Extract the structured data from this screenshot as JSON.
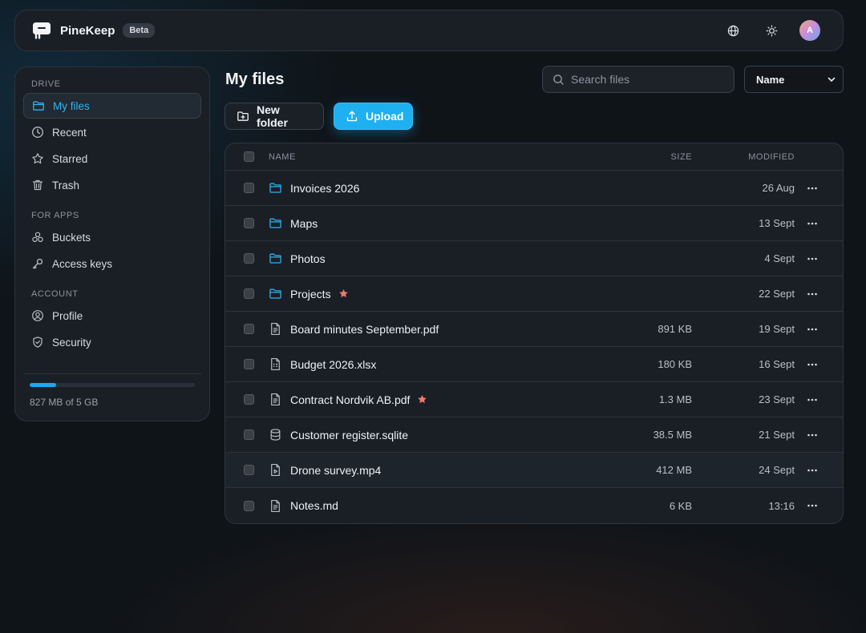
{
  "app": {
    "name": "PineKeep",
    "badge": "Beta"
  },
  "header": {
    "avatar_initial": "A"
  },
  "sidebar": {
    "sections": [
      {
        "label": "DRIVE",
        "items": [
          {
            "label": "My files",
            "icon": "folder-icon",
            "active": true
          },
          {
            "label": "Recent",
            "icon": "clock-icon"
          },
          {
            "label": "Starred",
            "icon": "star-icon"
          },
          {
            "label": "Trash",
            "icon": "trash-icon"
          }
        ]
      },
      {
        "label": "FOR APPS",
        "items": [
          {
            "label": "Buckets",
            "icon": "buckets-icon"
          },
          {
            "label": "Access keys",
            "icon": "key-icon"
          }
        ]
      },
      {
        "label": "ACCOUNT",
        "items": [
          {
            "label": "Profile",
            "icon": "user-circle-icon"
          },
          {
            "label": "Security",
            "icon": "shield-icon"
          }
        ]
      }
    ],
    "storage": {
      "text": "827 MB of 5 GB",
      "used_fraction": 0.16
    }
  },
  "main": {
    "title": "My files",
    "search_placeholder": "Search files",
    "sort_selected": "Name",
    "new_folder_label": "New folder",
    "upload_label": "Upload",
    "columns": {
      "name": "NAME",
      "size": "SIZE",
      "modified": "MODIFIED"
    },
    "files": [
      {
        "name": "Invoices 2026",
        "type": "folder",
        "size": "",
        "modified": "26 Aug",
        "starred": false
      },
      {
        "name": "Maps",
        "type": "folder",
        "size": "",
        "modified": "13 Sept",
        "starred": false
      },
      {
        "name": "Photos",
        "type": "folder",
        "size": "",
        "modified": "4 Sept",
        "starred": false
      },
      {
        "name": "Projects",
        "type": "folder",
        "size": "",
        "modified": "22 Sept",
        "starred": true
      },
      {
        "name": "Board minutes September.pdf",
        "type": "doc",
        "size": "891 KB",
        "modified": "19 Sept",
        "starred": false
      },
      {
        "name": "Budget 2026.xlsx",
        "type": "sheet",
        "size": "180 KB",
        "modified": "16 Sept",
        "starred": false
      },
      {
        "name": "Contract Nordvik AB.pdf",
        "type": "doc",
        "size": "1.3 MB",
        "modified": "23 Sept",
        "starred": true
      },
      {
        "name": "Customer register.sqlite",
        "type": "database",
        "size": "38.5 MB",
        "modified": "21 Sept",
        "starred": false
      },
      {
        "name": "Drone survey.mp4",
        "type": "video",
        "size": "412 MB",
        "modified": "24 Sept",
        "starred": false,
        "hover": true
      },
      {
        "name": "Notes.md",
        "type": "doc",
        "size": "6 KB",
        "modified": "13:16",
        "starred": false
      }
    ]
  },
  "colors": {
    "accent": "#1eb0f0",
    "star": "#f0786a",
    "background": "#0f1419",
    "panel": "#1a1f26"
  }
}
